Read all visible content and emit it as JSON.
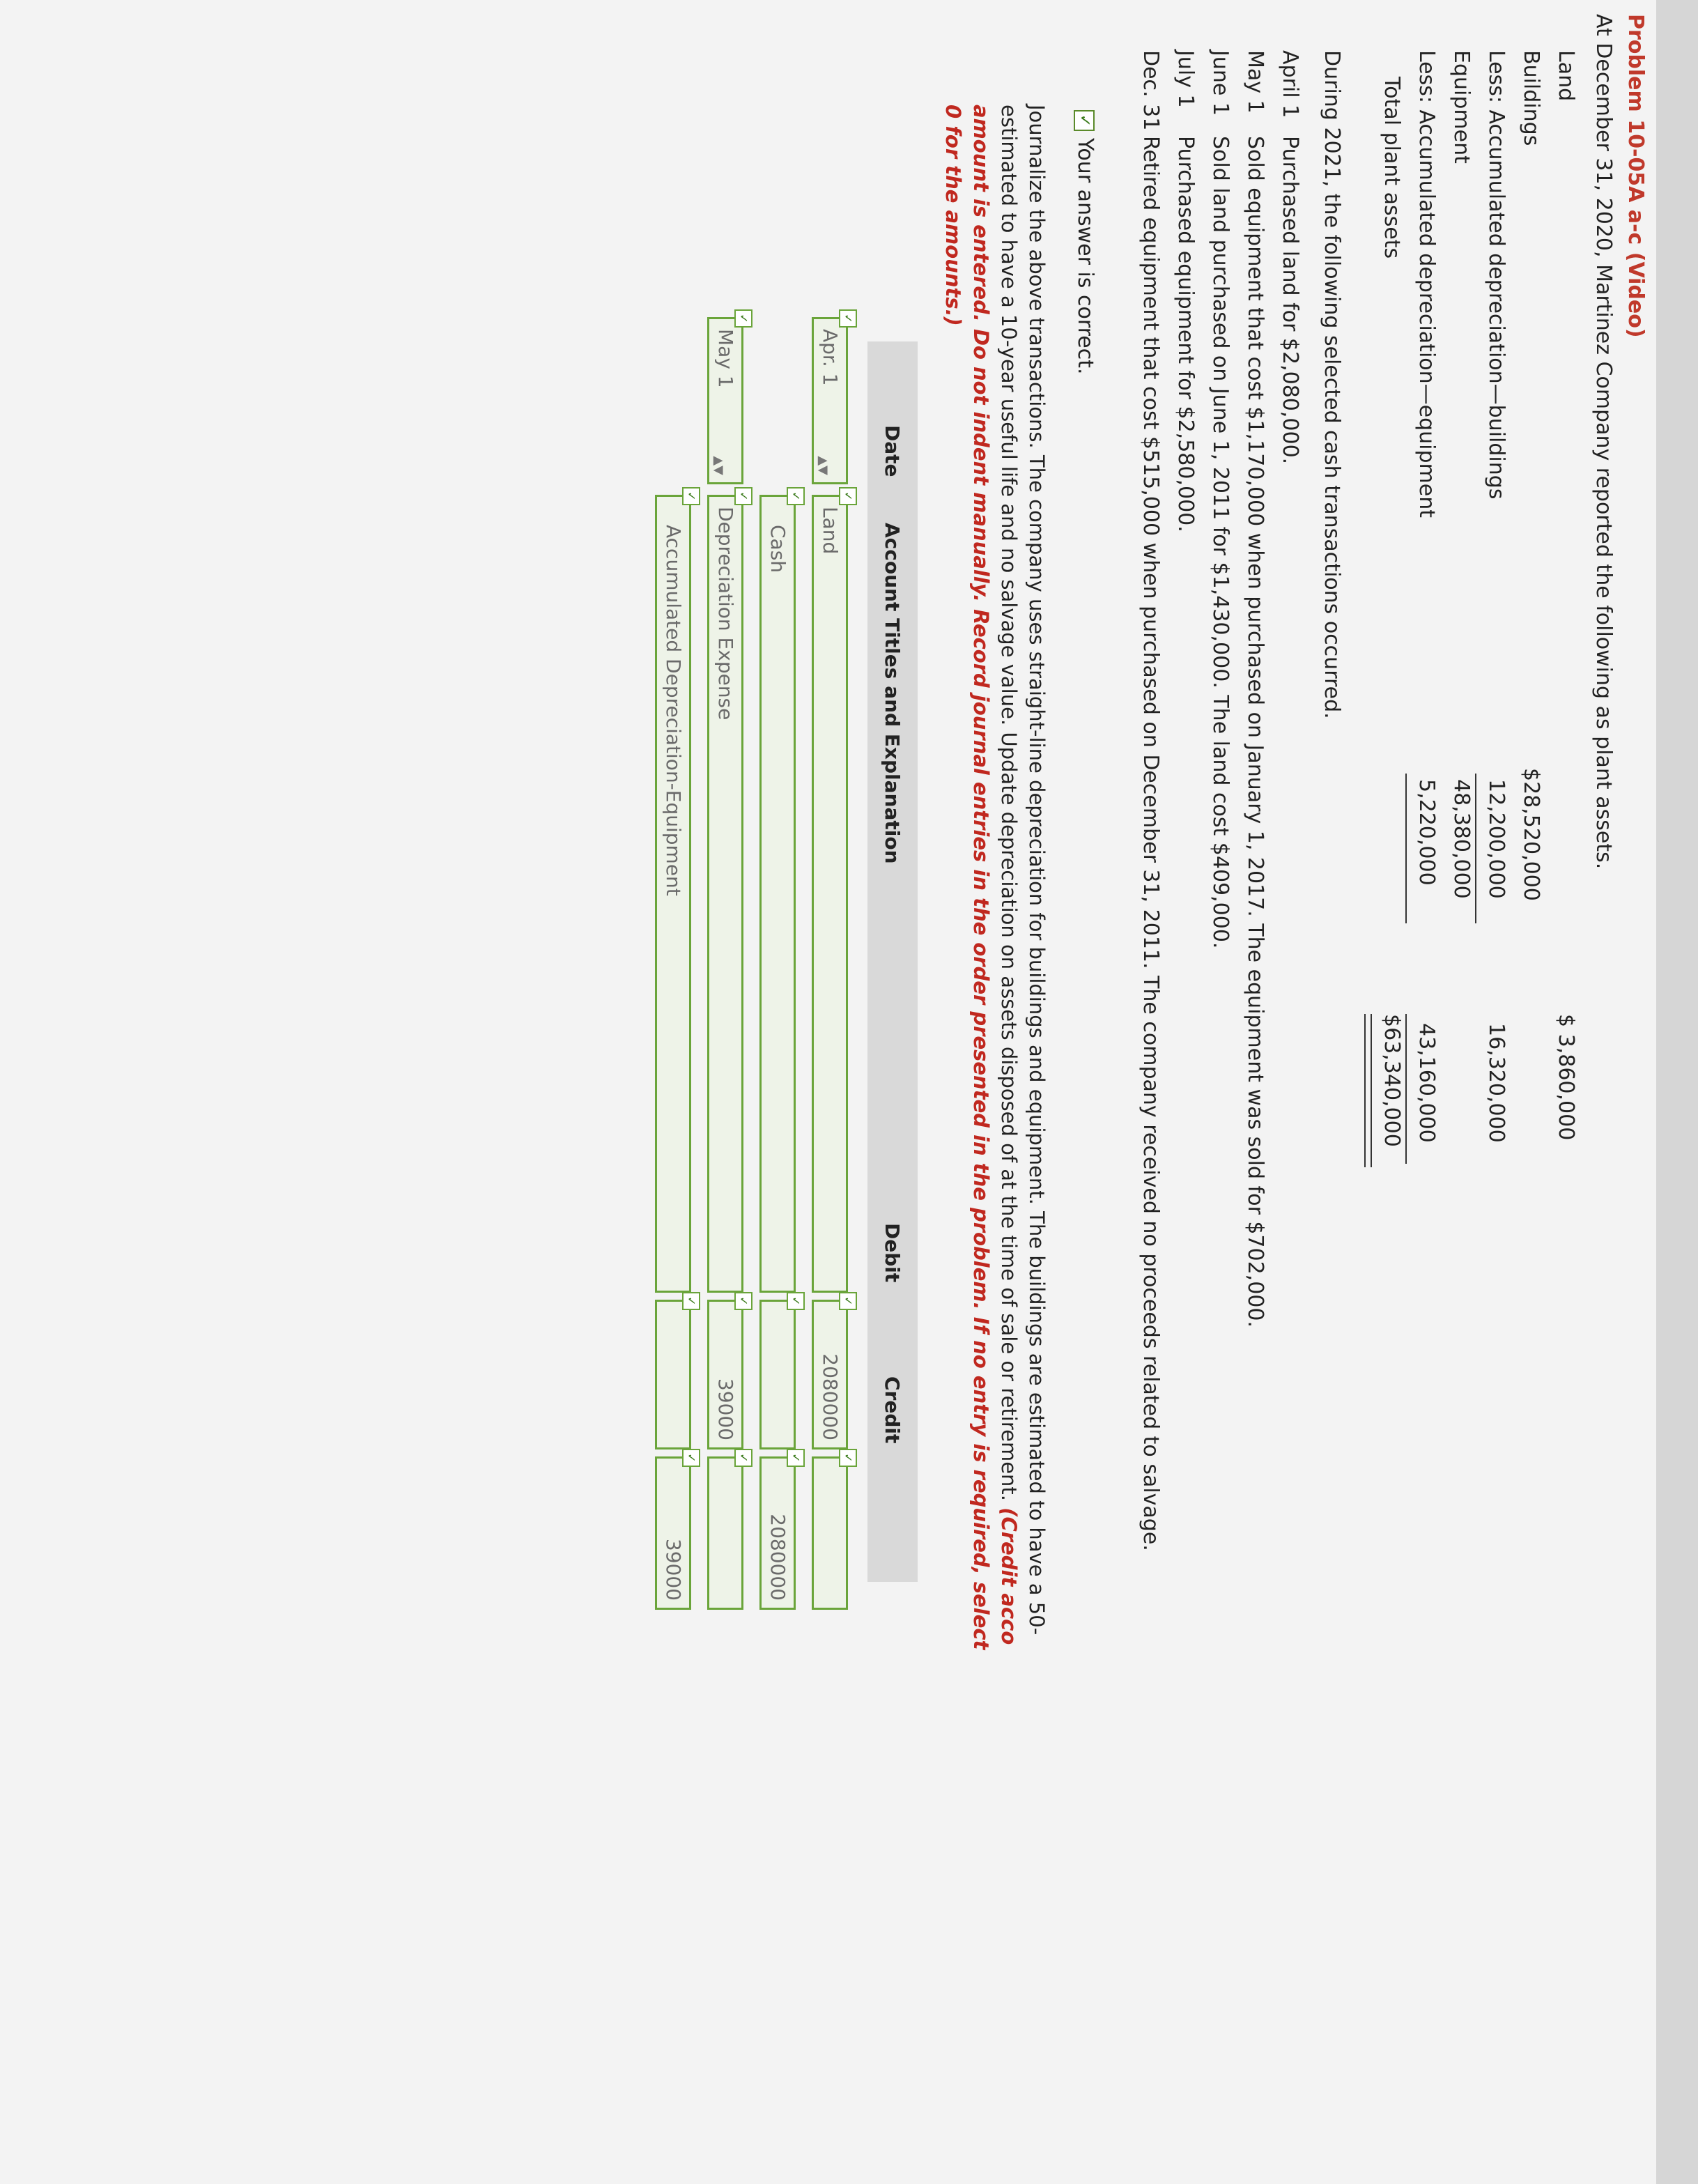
{
  "problem": {
    "title": "Problem 10-05A a-c (Video)",
    "intro": "At December 31, 2020, Martinez Company reported the following as plant assets."
  },
  "plant_assets": {
    "land_label": "Land",
    "land_value": "$ 3,860,000",
    "buildings_label": "Buildings",
    "buildings_value": "$28,520,000",
    "acc_dep_buildings_label": "Less: Accumulated depreciation—buildings",
    "acc_dep_buildings_value": "12,200,000",
    "buildings_net": "16,320,000",
    "equipment_label": "Equipment",
    "equipment_value": "48,380,000",
    "acc_dep_equipment_label": "Less: Accumulated depreciation—equipment",
    "acc_dep_equipment_value": "5,220,000",
    "equipment_net": "43,160,000",
    "total_label": "Total plant assets",
    "total_value": "$63,340,000"
  },
  "transactions_intro": "During 2021, the following selected cash transactions occurred.",
  "transactions": [
    {
      "date": "April 1",
      "text": "Purchased land for $2,080,000."
    },
    {
      "date": "May 1",
      "text": "Sold equipment that cost $1,170,000 when purchased on January 1, 2017. The equipment was sold for $702,000."
    },
    {
      "date": "June 1",
      "text": "Sold land purchased on June 1, 2011 for $1,430,000. The land cost $409,000."
    },
    {
      "date": "July 1",
      "text": "Purchased equipment for $2,580,000."
    },
    {
      "date": "Dec. 31",
      "text": "Retired equipment that cost $515,000 when purchased on December 31, 2011. The company received no proceeds related to salvage."
    }
  ],
  "status": {
    "correct_text": "Your answer is correct."
  },
  "instructions": {
    "line1": "Journalize the above transactions. The company uses straight-line depreciation for buildings and equipment. The buildings are estimated to have a 50-",
    "line2_plain": "estimated to have a 10-year useful life and no salvage value. Update depreciation on assets disposed of at the time of sale or retirement.",
    "line2_red": "(Credit acco",
    "line3": "amount is entered. Do not indent manually. Record journal entries in the order presented in the problem. If no entry is required, select",
    "line4": "0 for the amounts.)"
  },
  "journal": {
    "headers": {
      "date": "Date",
      "account": "Account Titles and Explanation",
      "debit": "Debit",
      "credit": "Credit"
    },
    "rows": [
      {
        "date": "Apr. 1",
        "account": "Land",
        "debit": "2080000",
        "credit": ""
      },
      {
        "date": "",
        "account": "Cash",
        "debit": "",
        "credit": "2080000"
      },
      {
        "date": "May 1",
        "account": "Depreciation Expense",
        "debit": "39000",
        "credit": ""
      },
      {
        "date": "",
        "account": "Accumulated Depreciation-Equipment",
        "debit": "",
        "credit": "39000"
      }
    ]
  }
}
